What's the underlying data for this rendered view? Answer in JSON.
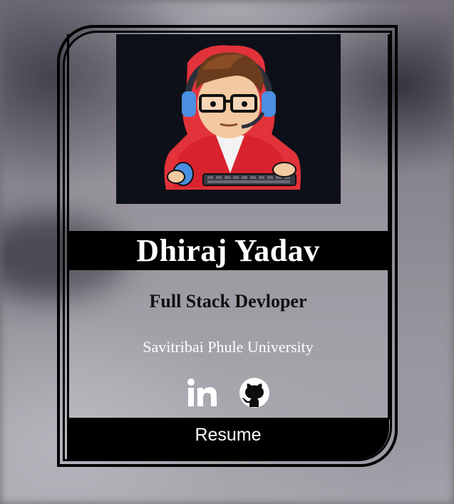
{
  "profile": {
    "name": "Dhiraj Yadav",
    "role": "Full Stack Devloper",
    "university": "Savitribai Phule University"
  },
  "avatar": {
    "icon": "gamer-avatar-illustration",
    "background_color": "#0d1018"
  },
  "socials": [
    {
      "icon": "linkedin-icon"
    },
    {
      "icon": "github-icon"
    }
  ],
  "actions": {
    "resume_label": "Resume"
  },
  "colors": {
    "frame": "#000000",
    "accent_red": "#e2323a",
    "text_light": "#ffffff"
  }
}
